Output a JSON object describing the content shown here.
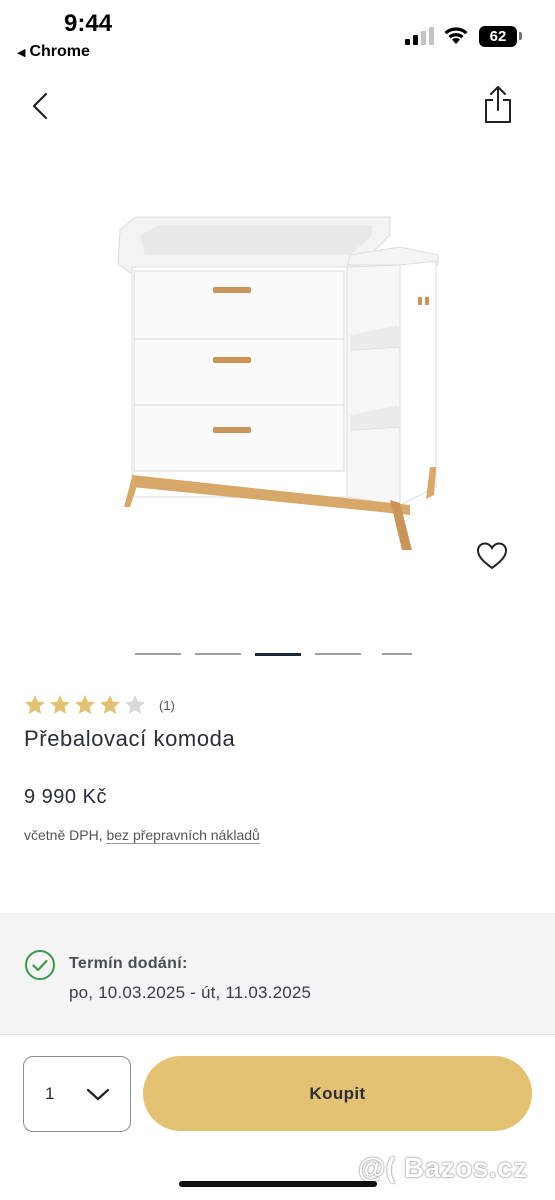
{
  "status_bar": {
    "time": "9:44",
    "back_app": "Chrome",
    "battery": "62"
  },
  "product": {
    "rating_count": "(1)",
    "rating_value": 4,
    "rating_max": 5,
    "title": "Přebalovací komoda",
    "price": "9 990 Kč",
    "tax_note_prefix": "včetně DPH, ",
    "tax_note_link": "bez přepravních nákladů"
  },
  "carousel": {
    "slide_count": 5,
    "active_index": 2
  },
  "delivery": {
    "label": "Termín dodání:",
    "date": "po, 10.03.2025 - út, 11.03.2025"
  },
  "buy_bar": {
    "quantity": "1",
    "buy_label": "Koupit"
  },
  "watermark": "@( Bazos.cz",
  "colors": {
    "accent": "#e4c274",
    "star": "#e4c274",
    "star_empty": "#d9d9d9",
    "success": "#3a9a4a",
    "active_dot": "#1d2633"
  }
}
